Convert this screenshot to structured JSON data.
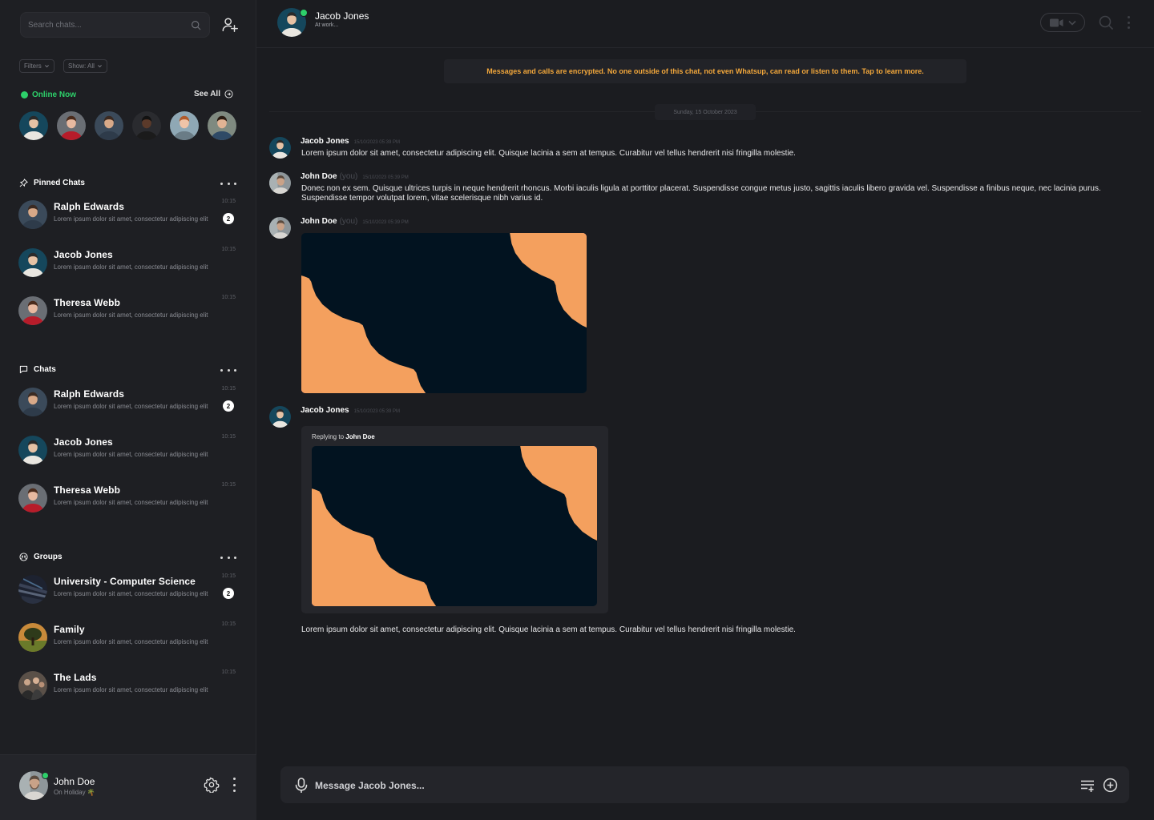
{
  "search": {
    "placeholder": "Search chats..."
  },
  "filters": {
    "filters_label": "Filters",
    "show_label": "Show: All"
  },
  "online": {
    "title": "Online Now",
    "see_all": "See All",
    "users": [
      {
        "bg": "#15475c",
        "skin": "#e6c2a5",
        "hair": "#2a2a2a",
        "shirt": "#e9e6e0"
      },
      {
        "bg": "#6a6e74",
        "skin": "#e8b9a0",
        "hair": "#4a2b1c",
        "shirt": "#b71c2a"
      },
      {
        "bg": "#3b4a5a",
        "skin": "#d8a988",
        "hair": "#3a2a22",
        "shirt": "#2e3b4a"
      },
      {
        "bg": "#2a2b2f",
        "skin": "#5b3a2a",
        "hair": "#121212",
        "shirt": "#1b1b1b"
      },
      {
        "bg": "#8fa8b5",
        "skin": "#f0c4a8",
        "hair": "#b05a2a",
        "shirt": "#6a7c86"
      },
      {
        "bg": "#7f8a80",
        "skin": "#e1b394",
        "hair": "#2a1c12",
        "shirt": "#2f4a66"
      }
    ]
  },
  "pinned": {
    "title": "Pinned Chats",
    "items": [
      {
        "name": "Ralph Edwards",
        "preview": "Lorem ipsum dolor sit amet, consectetur adipiscing elit",
        "time": "10:15",
        "badge": "2"
      },
      {
        "name": "Jacob Jones",
        "preview": "Lorem ipsum dolor sit amet, consectetur adipiscing elit",
        "time": "10:15"
      },
      {
        "name": "Theresa Webb",
        "preview": "Lorem ipsum dolor sit amet, consectetur adipiscing elit",
        "time": "10:15"
      }
    ]
  },
  "chats": {
    "title": "Chats",
    "items": [
      {
        "name": "Ralph Edwards",
        "preview": "Lorem ipsum dolor sit amet, consectetur adipiscing elit",
        "time": "10:15",
        "badge": "2"
      },
      {
        "name": "Jacob Jones",
        "preview": "Lorem ipsum dolor sit amet, consectetur adipiscing elit",
        "time": "10:15"
      },
      {
        "name": "Theresa Webb",
        "preview": "Lorem ipsum dolor sit amet, consectetur adipiscing elit",
        "time": "10:15"
      }
    ]
  },
  "groups": {
    "title": "Groups",
    "items": [
      {
        "name": "University - Computer Science",
        "preview": "Lorem ipsum dolor sit amet, consectetur adipiscing elit",
        "time": "10:15",
        "badge": "2"
      },
      {
        "name": "Family",
        "preview": "Lorem ipsum dolor sit amet, consectetur adipiscing elit",
        "time": "10:15"
      },
      {
        "name": "The Lads",
        "preview": "Lorem ipsum dolor sit amet, consectetur adipiscing elit",
        "time": "10:15"
      }
    ]
  },
  "me": {
    "name": "John Doe",
    "status": "On Holiday 🌴"
  },
  "conversation": {
    "contact_name": "Jacob Jones",
    "contact_status": "At work...",
    "encryption_notice": "Messages and calls are encrypted. No one outside of this chat, not even Whatsup, can read or listen to them. Tap to learn more.",
    "date_separator": "Sunday, 15 October 2023",
    "messages": [
      {
        "author": "Jacob Jones",
        "you": "",
        "time": "15/10/2023 05:39 PM",
        "text": "Lorem ipsum dolor sit amet, consectetur adipiscing elit. Quisque lacinia a sem at tempus. Curabitur vel tellus hendrerit nisi fringilla molestie."
      },
      {
        "author": "John Doe",
        "you": "(you)",
        "time": "15/10/2023 05:39 PM",
        "text": "Donec non ex sem. Quisque ultrices turpis in neque hendrerit rhoncus. Morbi iaculis ligula at porttitor placerat. Suspendisse congue metus justo, sagittis iaculis libero gravida vel. Suspendisse a finibus neque, nec lacinia purus. Suspendisse tempor volutpat lorem, vitae scelerisque nibh varius id."
      },
      {
        "author": "John Doe",
        "you": "(you)",
        "time": "15/10/2023 05:39 PM",
        "text": ""
      },
      {
        "author": "Jacob Jones",
        "you": "",
        "time": "15/10/2023 05:39 PM",
        "reply_prefix": "Replying to",
        "reply_to": "John Doe",
        "text": "Lorem ipsum dolor sit amet, consectetur adipiscing elit. Quisque lacinia a sem at tempus. Curabitur vel tellus hendrerit nisi fringilla molestie."
      }
    ]
  },
  "composer": {
    "placeholder": "Message Jacob Jones..."
  },
  "colors": {
    "online": "#2dd06a",
    "encryption_text": "#f2a73b",
    "background": "#1b1c20",
    "sidebar": "#1e1f23"
  }
}
